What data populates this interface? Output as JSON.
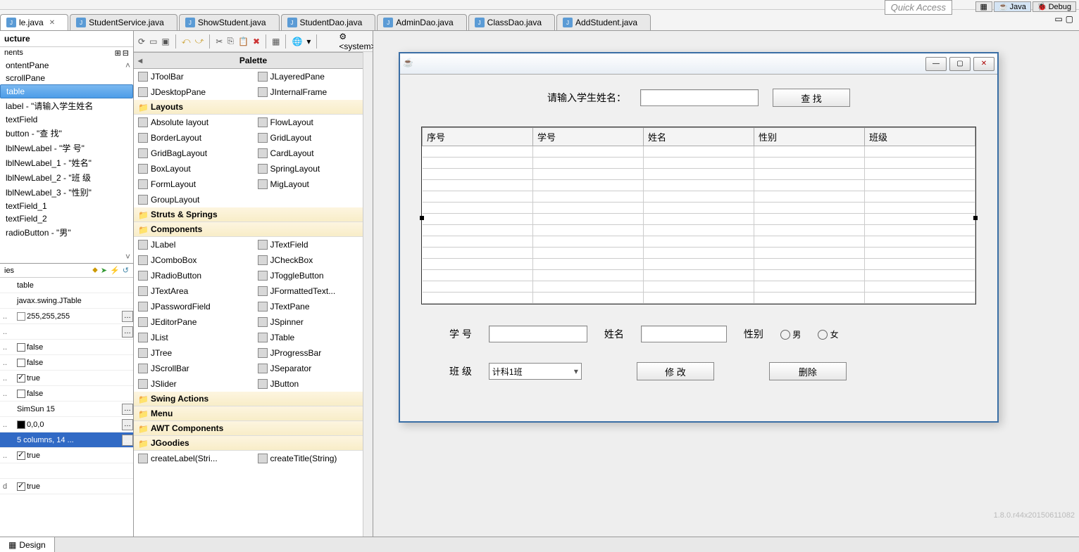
{
  "topbar": {
    "quick_access": "Quick Access",
    "perspectives": [
      "Java",
      "Debug"
    ]
  },
  "tabs": [
    {
      "label": "le.java",
      "active": true,
      "close": true
    },
    {
      "label": "StudentService.java"
    },
    {
      "label": "ShowStudent.java"
    },
    {
      "label": "StudentDao.java"
    },
    {
      "label": "AdminDao.java"
    },
    {
      "label": "ClassDao.java"
    },
    {
      "label": "AddStudent.java"
    }
  ],
  "structure": {
    "title": "ucture",
    "subtitle": "nents",
    "items": [
      "ontentPane",
      "scrollPane",
      "table",
      "label - \"请输入学生姓名",
      "textField",
      "button - \"查  找\"",
      "lblNewLabel - \"学  号\"",
      "lblNewLabel_1 - \"姓名\"",
      "lblNewLabel_2 - \"班  级",
      "lblNewLabel_3 - \"性别\"",
      "textField_1",
      "textField_2",
      "radioButton - \"男\""
    ],
    "selected_index": 2
  },
  "properties": {
    "title": "ies",
    "rows": [
      {
        "val": "table"
      },
      {
        "val": "javax.swing.JTable"
      },
      {
        "val": "255,255,255",
        "color": "#ffffff",
        "btn": true
      },
      {
        "val": "",
        "btn": true
      },
      {
        "val": "false",
        "check": false
      },
      {
        "val": "false",
        "check": false
      },
      {
        "val": "true",
        "check": true
      },
      {
        "val": "false",
        "check": false
      },
      {
        "val": "SimSun 15",
        "btn": true
      },
      {
        "val": "0,0,0",
        "color": "#000000",
        "btn": true
      },
      {
        "val": "5 columns, 14 ...",
        "selected": true,
        "btn": true
      },
      {
        "val": "true",
        "check": true
      },
      {
        "val": "",
        "blank": true
      },
      {
        "val": "true",
        "check": true
      }
    ]
  },
  "palette_toolbar": {
    "system": "<system>"
  },
  "palette": {
    "header": "Palette",
    "precat_items": [
      [
        "JToolBar",
        "JLayeredPane"
      ],
      [
        "JDesktopPane",
        "JInternalFrame"
      ]
    ],
    "categories": [
      {
        "name": "Layouts",
        "items": [
          [
            "Absolute layout",
            "FlowLayout"
          ],
          [
            "BorderLayout",
            "GridLayout"
          ],
          [
            "GridBagLayout",
            "CardLayout"
          ],
          [
            "BoxLayout",
            "SpringLayout"
          ],
          [
            "FormLayout",
            "MigLayout"
          ],
          [
            "GroupLayout",
            ""
          ]
        ]
      },
      {
        "name": "Struts & Springs",
        "items": []
      },
      {
        "name": "Components",
        "items": [
          [
            "JLabel",
            "JTextField"
          ],
          [
            "JComboBox",
            "JCheckBox"
          ],
          [
            "JRadioButton",
            "JToggleButton"
          ],
          [
            "JTextArea",
            "JFormattedText..."
          ],
          [
            "JPasswordField",
            "JTextPane"
          ],
          [
            "JEditorPane",
            "JSpinner"
          ],
          [
            "JList",
            "JTable"
          ],
          [
            "JTree",
            "JProgressBar"
          ],
          [
            "JScrollBar",
            "JSeparator"
          ],
          [
            "JSlider",
            "JButton"
          ]
        ]
      },
      {
        "name": "Swing Actions",
        "items": []
      },
      {
        "name": "Menu",
        "items": []
      },
      {
        "name": "AWT Components",
        "items": []
      },
      {
        "name": "JGoodies",
        "items": [
          [
            "createLabel(Stri...",
            "createTitle(String)"
          ]
        ]
      }
    ]
  },
  "form": {
    "search_label": "请输入学生姓名：",
    "search_btn": "查    找",
    "table_headers": [
      "序号",
      "学号",
      "姓名",
      "性别",
      "班级"
    ],
    "table_rows": 14,
    "lbl_id": "学    号",
    "lbl_name": "姓名",
    "lbl_gender": "性别",
    "radio_male": "男",
    "radio_female": "女",
    "lbl_class": "班    级",
    "combo_class": "计科1班",
    "btn_modify": "修    改",
    "btn_delete": "删除"
  },
  "bottom": {
    "design": "Design",
    "version": "1.8.0.r44x20150611082"
  }
}
